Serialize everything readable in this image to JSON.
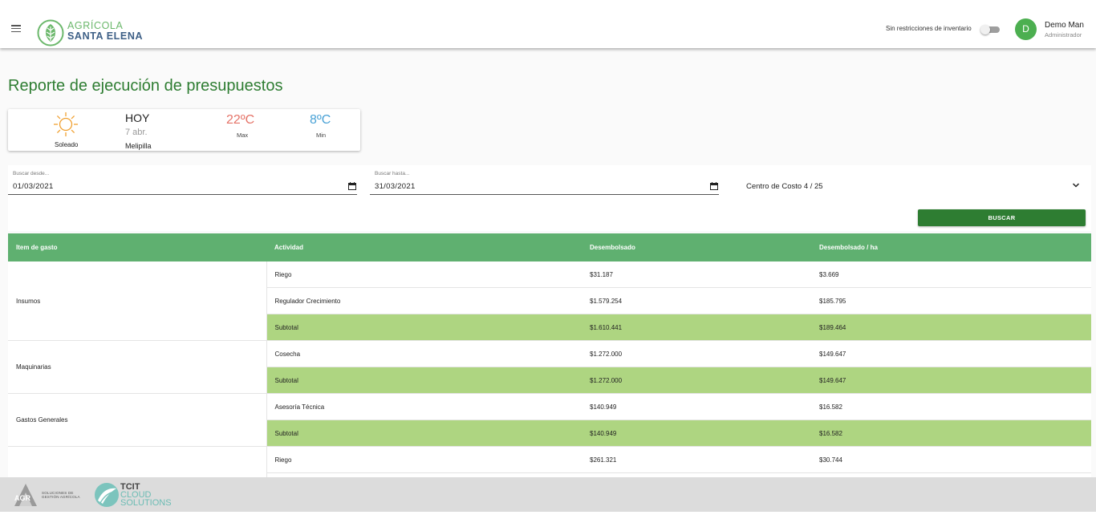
{
  "header": {
    "brand_line1": "AGRÍCOLA",
    "brand_line2": "SANTA ELENA",
    "inventory_label": "Sin restricciones de inventario",
    "inventory_toggle_on": false,
    "avatar_initial": "D",
    "user_name": "Demo Man",
    "user_role": "Administrador",
    "accent_color": "#4caf50"
  },
  "page": {
    "title": "Reporte de ejecución de presupuestos"
  },
  "weather": {
    "icon": "sun-icon",
    "condition": "Soleado",
    "today": "HOY",
    "date": "7 abr.",
    "city": "Melipilla",
    "max_temp": "22ºC",
    "max_label": "Max",
    "min_temp": "8ºC",
    "min_label": "Min"
  },
  "filters": {
    "from_label": "Buscar desde...",
    "from_value": "01/03/2021",
    "to_label": "Buscar hasta...",
    "to_value": "31/03/2021",
    "cost_center": "Centro de Costo 4 / 25",
    "search_button": "BUSCAR"
  },
  "table": {
    "columns": [
      "Item de gasto",
      "Actividad",
      "Desembolsado",
      "Desembolsado / ha"
    ],
    "groups": [
      {
        "item": "Insumos",
        "rows": [
          {
            "activity": "Riego",
            "amount": "$31.187",
            "per_ha": "$3.669",
            "subtotal": false
          },
          {
            "activity": "Regulador Crecimiento",
            "amount": "$1.579.254",
            "per_ha": "$185.795",
            "subtotal": false
          },
          {
            "activity": "Subtotal",
            "amount": "$1.610.441",
            "per_ha": "$189.464",
            "subtotal": true
          }
        ]
      },
      {
        "item": "Maquinarias",
        "rows": [
          {
            "activity": "Cosecha",
            "amount": "$1.272.000",
            "per_ha": "$149.647",
            "subtotal": false
          },
          {
            "activity": "Subtotal",
            "amount": "$1.272.000",
            "per_ha": "$149.647",
            "subtotal": true
          }
        ]
      },
      {
        "item": "Gastos Generales",
        "rows": [
          {
            "activity": "Asesoría Técnica",
            "amount": "$140.949",
            "per_ha": "$16.582",
            "subtotal": false
          },
          {
            "activity": "Subtotal",
            "amount": "$140.949",
            "per_ha": "$16.582",
            "subtotal": true
          }
        ]
      },
      {
        "item": "",
        "rows": [
          {
            "activity": "Riego",
            "amount": "$261.321",
            "per_ha": "$30.744",
            "subtotal": false
          }
        ]
      }
    ],
    "header_color": "#5fb070",
    "subtotal_color": "#aed581"
  },
  "footer": {
    "agr_logo_text": "AGR",
    "agr_line1": "SOLUCIONES DE",
    "agr_line2": "GESTIÓN AGRÍCOLA",
    "tcit_line1": "TCIT",
    "tcit_line2": "CLOUD",
    "tcit_line3": "SOLUTIONS"
  }
}
